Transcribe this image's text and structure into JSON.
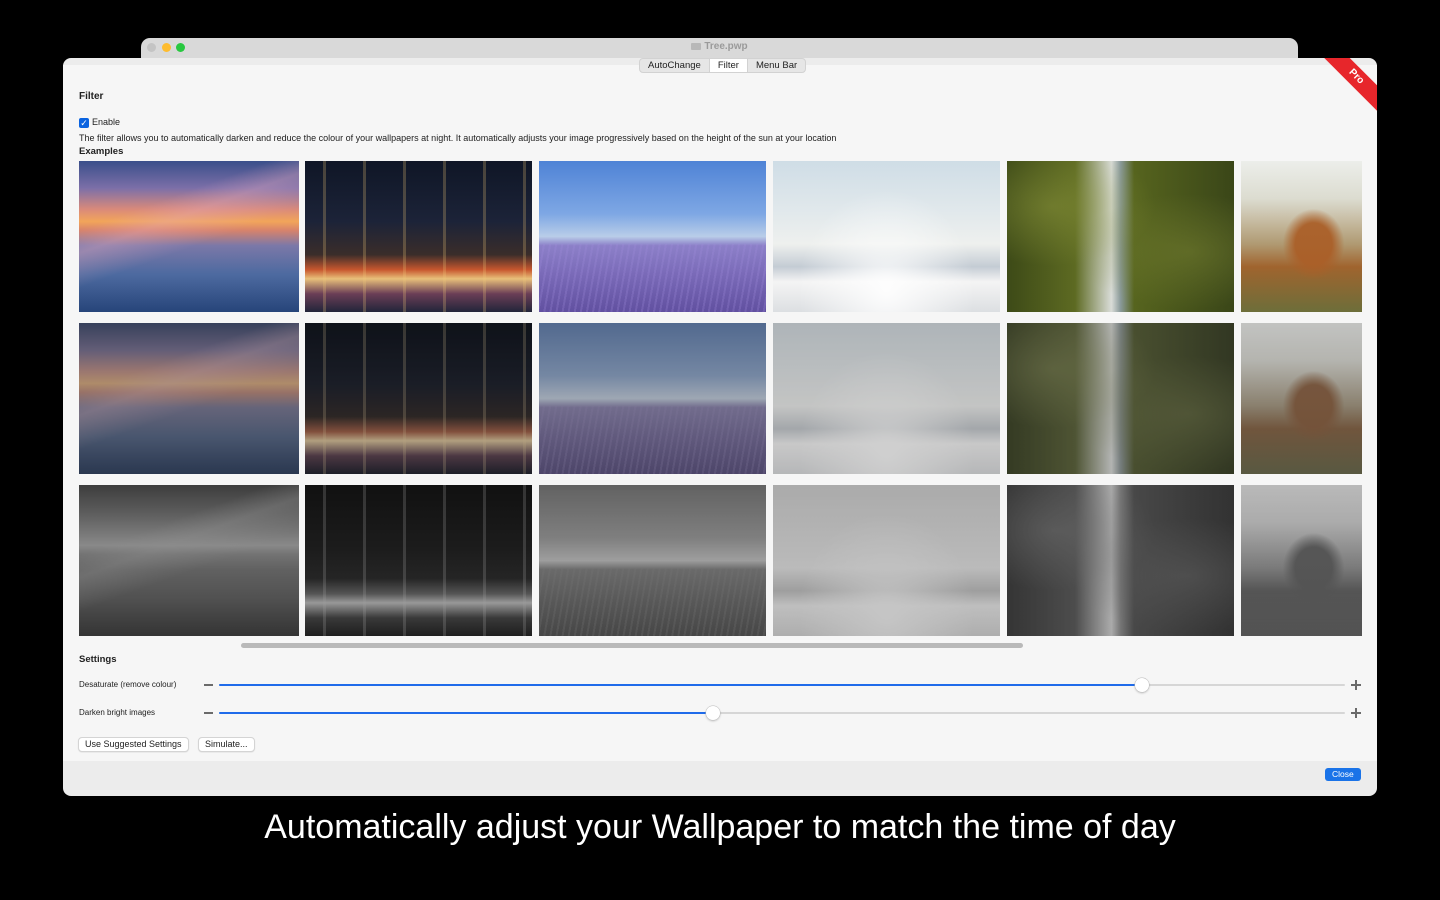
{
  "window": {
    "title": "Tree.pwp"
  },
  "tabs": [
    {
      "label": "AutoChange"
    },
    {
      "label": "Filter"
    },
    {
      "label": "Menu Bar"
    }
  ],
  "badge": {
    "label": "Pro",
    "color": "#e7262b"
  },
  "filter": {
    "heading": "Filter",
    "enable_label": "Enable",
    "enabled": true,
    "description": "The filter allows you to automatically darken and reduce the colour of your wallpapers at night. It automatically adjusts your image progressively based on the height of the sun at your location"
  },
  "examples": {
    "heading": "Examples",
    "columns": [
      "sunset-lake",
      "city-night-traffic",
      "lavender-field",
      "clouds-sky",
      "waterfall-canyon",
      "dog-flowers"
    ],
    "rows": [
      "original",
      "partially-filtered",
      "fully-filtered"
    ]
  },
  "settings": {
    "heading": "Settings",
    "sliders": [
      {
        "label": "Desaturate (remove colour)",
        "value": 0.82
      },
      {
        "label": "Darken bright images",
        "value": 0.439
      }
    ],
    "suggested_button": "Use Suggested Settings",
    "simulate_button": "Simulate..."
  },
  "footer": {
    "close_button": "Close"
  },
  "caption": "Automatically adjust your Wallpaper to match the time of day",
  "colors": {
    "accent": "#1f6bea",
    "background": "#000000"
  }
}
